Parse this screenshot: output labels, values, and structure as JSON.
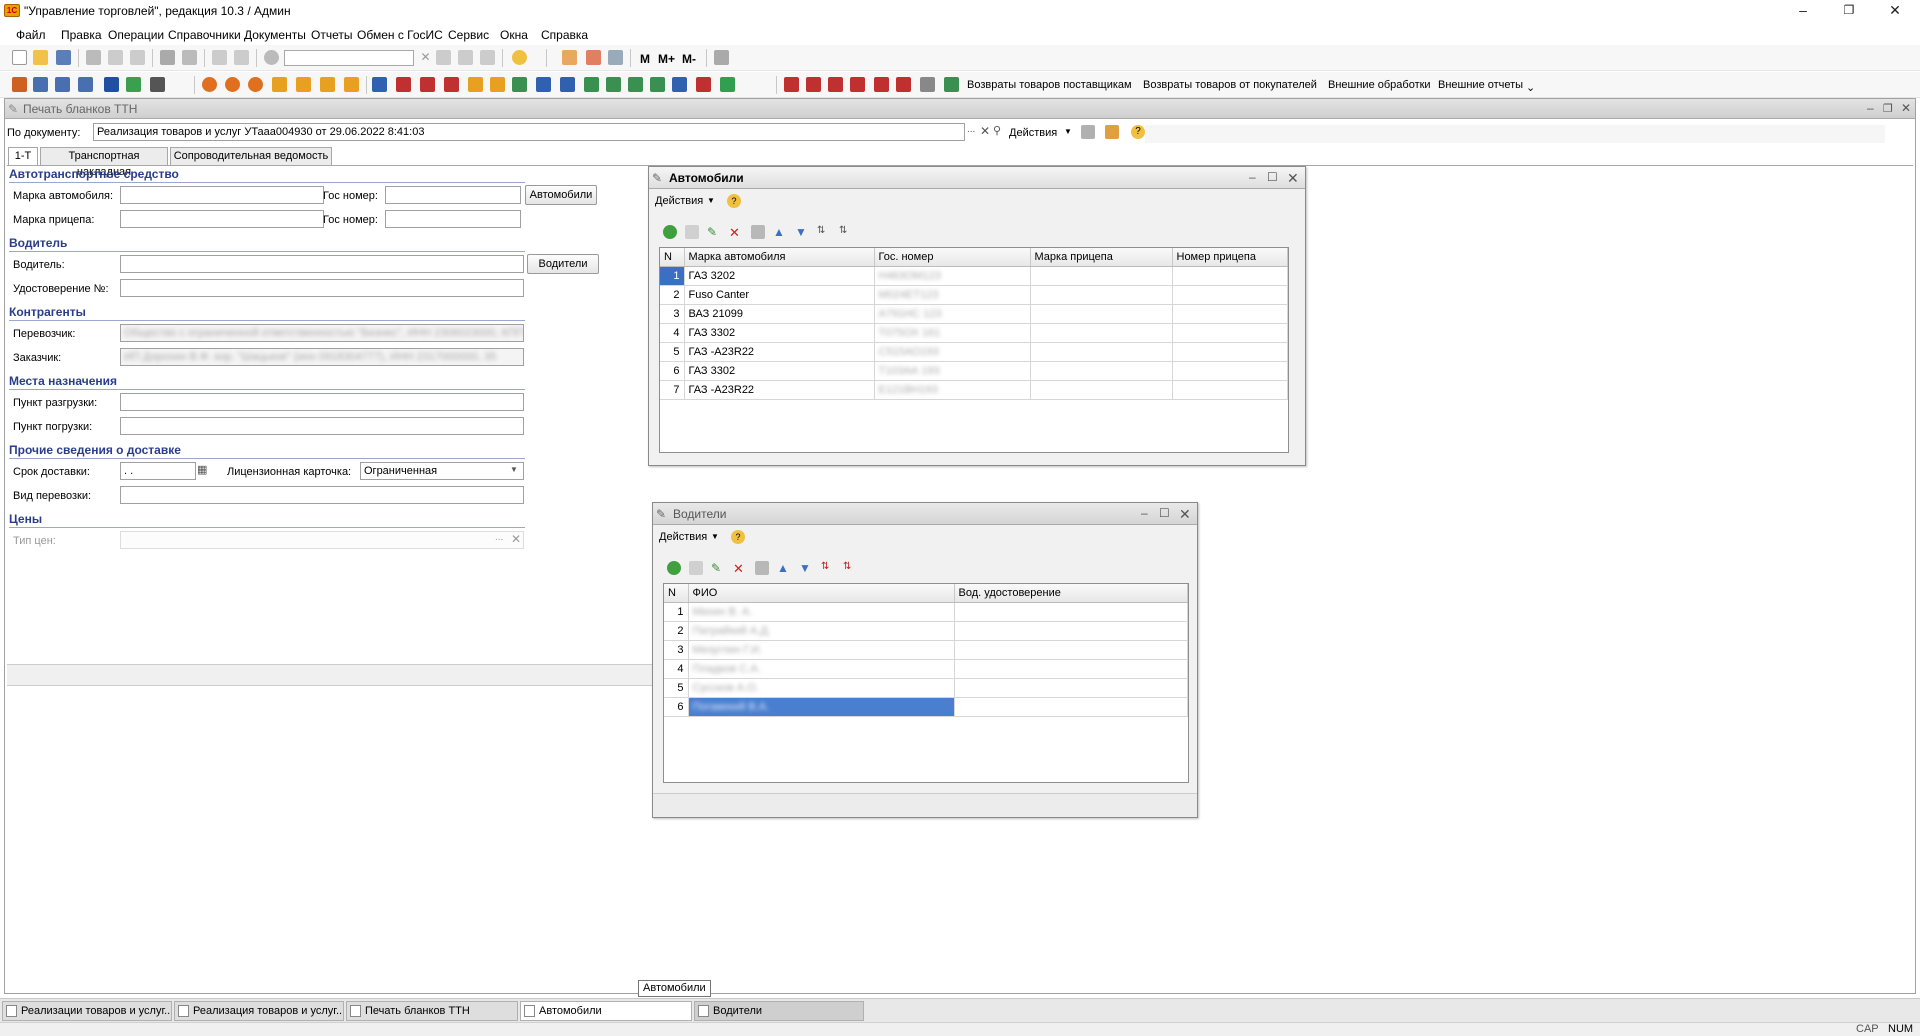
{
  "window": {
    "title": "\"Управление торговлей\", редакция 10.3 / Админ"
  },
  "menu": [
    "Файл",
    "Правка",
    "Операции",
    "Справочники",
    "Документы",
    "Отчеты",
    "Обмен с ГосИС",
    "Сервис",
    "Окна",
    "Справка"
  ],
  "toolbar2": {
    "link_returns_suppliers": "Возвраты товаров поставщикам",
    "link_returns_buyers": "Возвраты товаров от покупателей",
    "link_ext_processing": "Внешние обработки",
    "link_ext_reports": "Внешние отчеты"
  },
  "doc": {
    "title": "Печать бланков ТТН",
    "by_doc_label": "По документу:",
    "by_doc_value": "Реализация товаров и услуг УТааа004930 от 29.06.2022 8:41:03",
    "actions": "Действия",
    "tabs": [
      "1-Т",
      "Транспортная накладная",
      "Сопроводительная ведомость"
    ],
    "sections": {
      "vehicle": "Автотранспортное средство",
      "driver": "Водитель",
      "contractors": "Контрагенты",
      "destinations": "Места назначения",
      "other": "Прочие сведения о доставке",
      "prices": "Цены"
    },
    "labels": {
      "car_brand": "Марка автомобиля:",
      "gos_num": "Гос номер:",
      "trailer_brand": "Марка прицепа:",
      "gos_num2": "Гос номер:",
      "driver": "Водитель:",
      "license": "Удостоверение №:",
      "carrier": "Перевозчик:",
      "customer": "Заказчик:",
      "unload_point": "Пункт разгрузки:",
      "load_point": "Пункт погрузки:",
      "delivery_term": "Срок доставки:",
      "license_card": "Лицензионная карточка:",
      "transport_type": "Вид перевозки:",
      "price_type": "Тип цен:"
    },
    "buttons": {
      "cars": "Автомобили",
      "drivers": "Водители"
    },
    "values": {
      "carrier": "Общество с ограниченной ответственностью \"Бизнес\", ИНН 2306023000, КПП",
      "customer": "ИП Дорохин В.Ф. кор. \"Шацькое\" (инн 0918304777), ИНН 2317000000, 35",
      "delivery_term": " .  .",
      "license_card": "Ограниченная"
    }
  },
  "cars_window": {
    "title": "Автомобили",
    "actions": "Действия",
    "columns": [
      "N",
      "Марка автомобиля",
      "Гос. номер",
      "Марка прицепа",
      "Номер прицепа"
    ],
    "rows": [
      {
        "n": "1",
        "brand": "ГАЗ 3202",
        "num": "Н463ОМ123"
      },
      {
        "n": "2",
        "brand": "Fuso Canter",
        "num": "М024ЕТ123"
      },
      {
        "n": "3",
        "brand": "ВАЗ 21099",
        "num": "А791НС 123"
      },
      {
        "n": "4",
        "brand": "ГАЗ 3302",
        "num": "Т075ОХ 161"
      },
      {
        "n": "5",
        "brand": "ГАЗ -А23R22",
        "num": "С515АО193"
      },
      {
        "n": "6",
        "brand": "ГАЗ 3302",
        "num": "Т103АА 193"
      },
      {
        "n": "7",
        "brand": "ГАЗ -А23R22",
        "num": "Е121ВН193"
      }
    ]
  },
  "drivers_window": {
    "title": "Водители",
    "actions": "Действия",
    "columns": [
      "N",
      "ФИО",
      "Вод. удостоверение"
    ],
    "rows": [
      {
        "n": "1",
        "fio": "Мехин В. А."
      },
      {
        "n": "2",
        "fio": "Патрайкий А.Д."
      },
      {
        "n": "3",
        "fio": "Мезуглин Г.И."
      },
      {
        "n": "4",
        "fio": "Пладков С.А."
      },
      {
        "n": "5",
        "fio": "Суссков А.О."
      },
      {
        "n": "6",
        "fio": "Погавекий В.А."
      }
    ]
  },
  "taskbar": [
    "Реализации товаров и услуг...",
    "Реализация товаров и услуг...",
    "Печать бланков ТТН",
    "Автомобили",
    "Водители"
  ],
  "tooltip": "Автомобили",
  "status": {
    "cap": "CAP",
    "num": "NUM"
  }
}
